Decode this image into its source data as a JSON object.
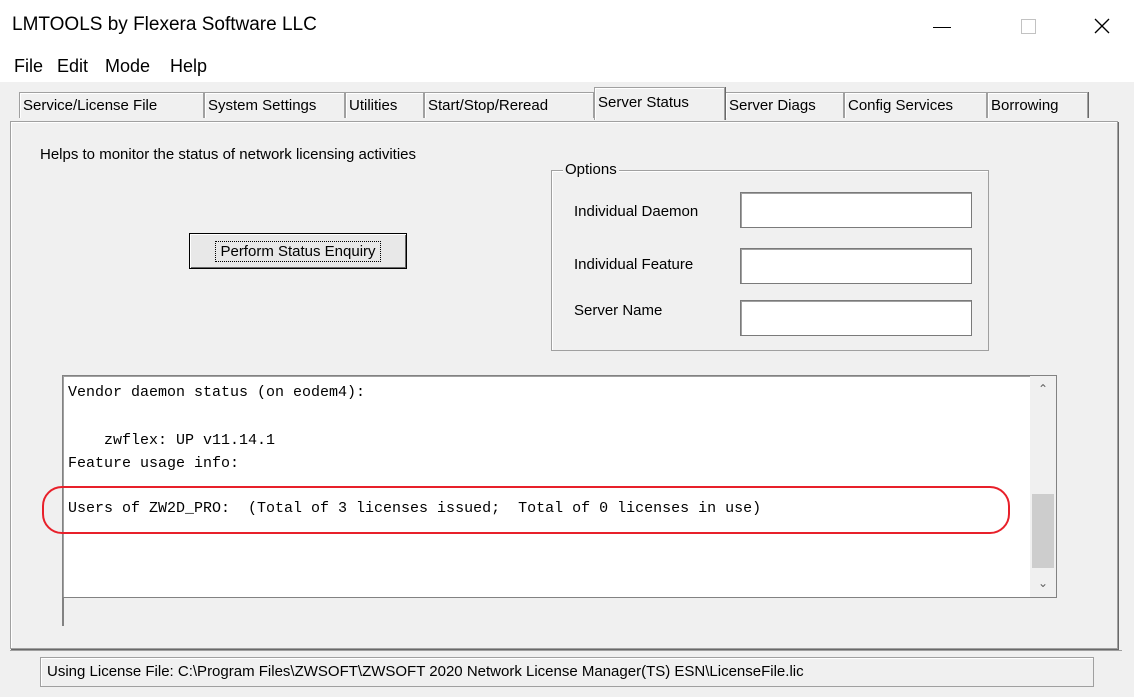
{
  "window": {
    "title": "LMTOOLS by Flexera Software LLC"
  },
  "menu": [
    "File",
    "Edit",
    "Mode",
    "Help"
  ],
  "tabs": [
    "Service/License File",
    "System Settings",
    "Utilities",
    "Start/Stop/Reread",
    "Server Status",
    "Server Diags",
    "Config Services",
    "Borrowing"
  ],
  "active_tab": "Server Status",
  "panel": {
    "helper_text": "Helps to monitor the status of network licensing activities",
    "status_button": "Perform Status Enquiry",
    "options": {
      "group_label": "Options",
      "daemon_label": "Individual Daemon",
      "daemon_value": "",
      "feature_label": "Individual Feature",
      "feature_value": "",
      "server_label": "Server Name",
      "server_value": ""
    }
  },
  "output": {
    "lines": [
      "Vendor daemon status (on eodem4):",
      "",
      "    zwflex: UP v11.14.1",
      "Feature usage info:",
      "",
      "Users of ZW2D_PRO:  (Total of 3 licenses issued;  Total of 0 licenses in use)"
    ],
    "highlight_color": "#e8202a"
  },
  "statusbar": {
    "text": "Using License File:  C:\\Program Files\\ZWSOFT\\ZWSOFT 2020 Network License Manager(TS) ESN\\LicenseFile.lic"
  }
}
